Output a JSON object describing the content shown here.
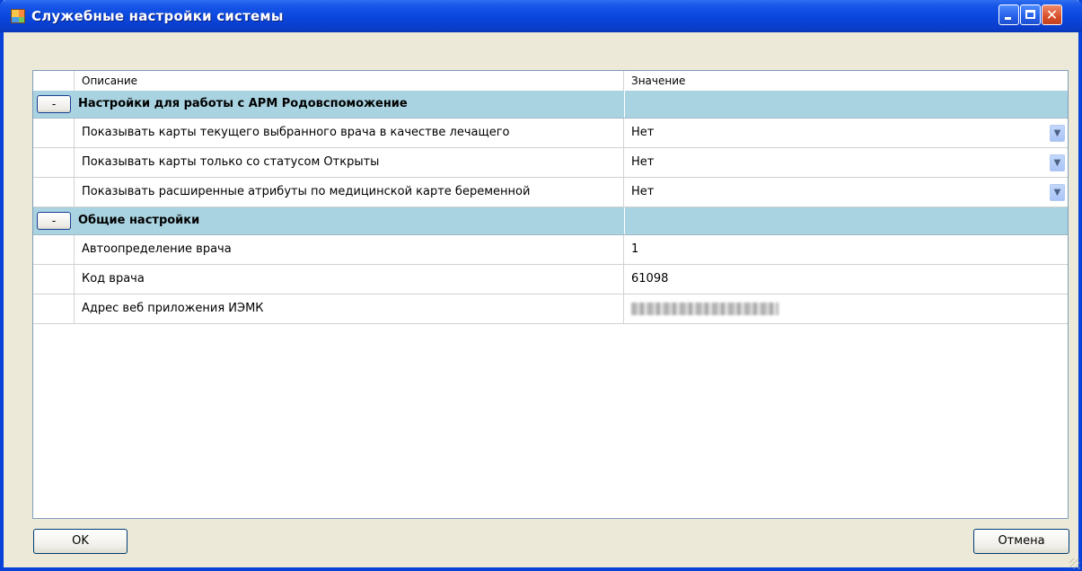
{
  "window": {
    "title": "Служебные настройки системы",
    "close_glyph": "✕"
  },
  "grid": {
    "columns": {
      "description": "Описание",
      "value": "Значение"
    },
    "groups": [
      {
        "expander": "-",
        "title": "Настройки для работы с АРМ Родовспоможение",
        "rows": [
          {
            "description": "Показывать карты текущего выбранного врача в качестве лечащего",
            "value": "Нет"
          },
          {
            "description": "Показывать карты только со статусом Открыты",
            "value": "Нет"
          },
          {
            "description": "Показывать расширенные атрибуты по медицинской карте беременной",
            "value": "Нет"
          }
        ]
      },
      {
        "expander": "-",
        "title": "Общие настройки",
        "rows": [
          {
            "description": "Автоопределение врача",
            "value": "1"
          },
          {
            "description": "Код врача",
            "value": "61098"
          },
          {
            "description": "Адрес веб приложения ИЭМК",
            "value": ""
          }
        ]
      }
    ]
  },
  "buttons": {
    "ok": "OK",
    "cancel": "Отмена"
  },
  "icons": {
    "dropdown": "chevron-down-icon",
    "app": "app-grid-icon"
  },
  "colors": {
    "titlebar": "#0a46dc",
    "group_row": "#a9d3e1",
    "frame": "#ece9d8"
  }
}
